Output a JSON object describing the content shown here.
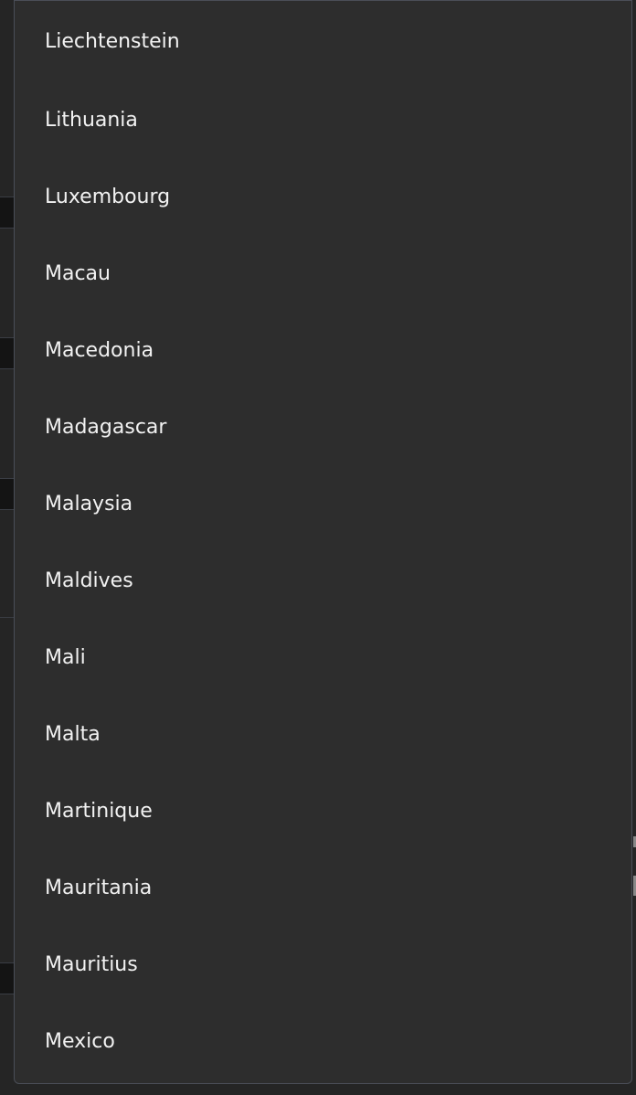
{
  "dropdown": {
    "options": [
      "Liechtenstein",
      "Lithuania",
      "Luxembourg",
      "Macau",
      "Macedonia",
      "Madagascar",
      "Malaysia",
      "Maldives",
      "Mali",
      "Malta",
      "Martinique",
      "Mauritania",
      "Mauritius",
      "Mexico"
    ]
  }
}
